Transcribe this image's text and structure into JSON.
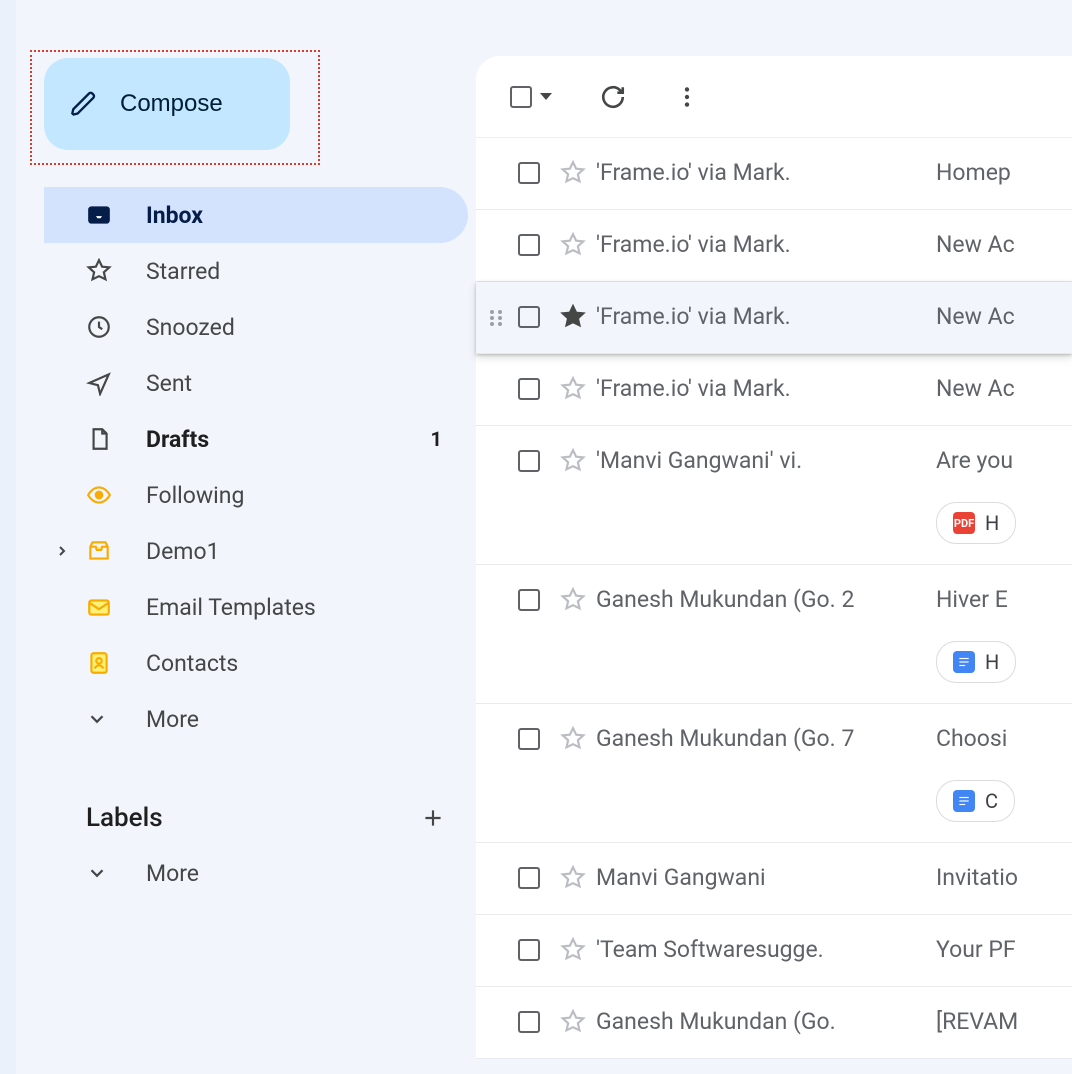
{
  "sidebar": {
    "compose_label": "Compose",
    "items": [
      {
        "label": "Inbox",
        "icon": "inbox",
        "active": true
      },
      {
        "label": "Starred",
        "icon": "star"
      },
      {
        "label": "Snoozed",
        "icon": "clock"
      },
      {
        "label": "Sent",
        "icon": "send"
      },
      {
        "label": "Drafts",
        "icon": "file",
        "bold": true,
        "count": "1"
      },
      {
        "label": "Following",
        "icon": "eye",
        "colored": true
      },
      {
        "label": "Demo1",
        "icon": "tray",
        "colored": true,
        "expandable": true
      },
      {
        "label": "Email Templates",
        "icon": "envelope",
        "colored": true
      },
      {
        "label": "Contacts",
        "icon": "contacts",
        "colored": true
      },
      {
        "label": "More",
        "icon": "chevron-down"
      }
    ],
    "labels_header": "Labels",
    "labels_more": "More"
  },
  "emails": [
    {
      "sender": "'Frame.io' via Mark.",
      "subject": "Homep"
    },
    {
      "sender": "'Frame.io' via Mark.",
      "subject": "New Ac"
    },
    {
      "sender": "'Frame.io' via Mark.",
      "subject": "New Ac",
      "hovered": true
    },
    {
      "sender": "'Frame.io' via Mark.",
      "subject": "New Ac"
    },
    {
      "sender": "'Manvi Gangwani' vi.",
      "subject": "Are you",
      "attachment": {
        "type": "pdf",
        "label": "H"
      }
    },
    {
      "sender": "Ganesh Mukundan (Go.",
      "thread_count": "2",
      "subject": "Hiver E",
      "attachment": {
        "type": "doc",
        "label": "H"
      }
    },
    {
      "sender": "Ganesh Mukundan (Go.",
      "thread_count": "7",
      "subject": "Choosi",
      "attachment": {
        "type": "doc",
        "label": "C"
      }
    },
    {
      "sender": "Manvi Gangwani",
      "subject": "Invitatio"
    },
    {
      "sender": "'Team Softwaresugge.",
      "subject": "Your PF"
    },
    {
      "sender": "Ganesh Mukundan (Go.",
      "subject": "[REVAM"
    }
  ]
}
